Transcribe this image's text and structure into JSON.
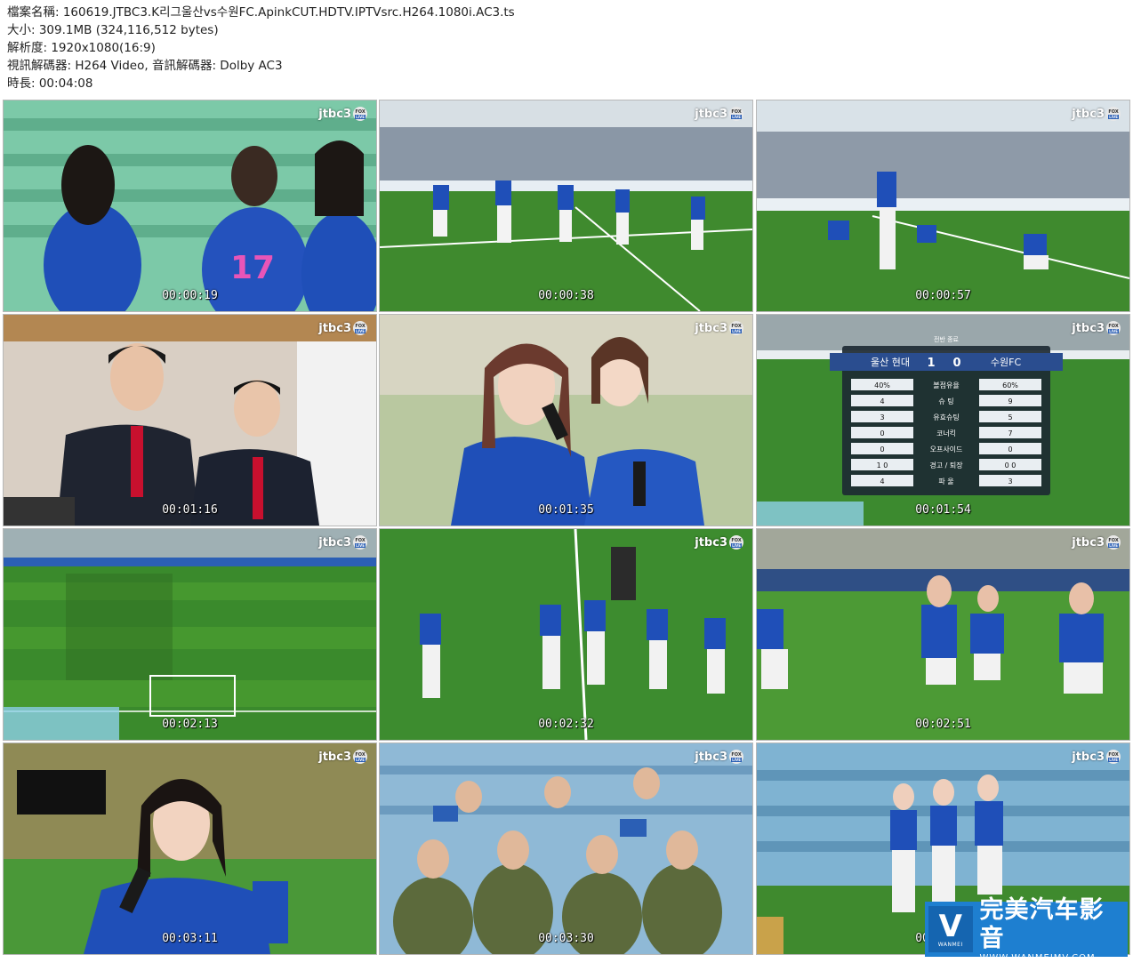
{
  "file_info": {
    "filename": "檔案名稱: 160619.JTBC3.K리그울산vs수원FC.ApinkCUT.HDTV.IPTVsrc.H264.1080i.AC3.ts",
    "size": "大小: 309.1MB (324,116,512 bytes)",
    "resolution": "解析度: 1920x1080(16:9)",
    "codecs": "視訊解碼器: H264 Video, 音訊解碼器: Dolby AC3",
    "duration": "時長: 00:04:08"
  },
  "broadcast_logo": {
    "brand": "jtbc3",
    "partner": "FOX",
    "live": "LIVE"
  },
  "thumbnails": [
    {
      "timestamp": "00:00:19"
    },
    {
      "timestamp": "00:00:38"
    },
    {
      "timestamp": "00:00:57"
    },
    {
      "timestamp": "00:01:16"
    },
    {
      "timestamp": "00:01:35"
    },
    {
      "timestamp": "00:01:54"
    },
    {
      "timestamp": "00:02:13"
    },
    {
      "timestamp": "00:02:32"
    },
    {
      "timestamp": "00:02:51"
    },
    {
      "timestamp": "00:03:11"
    },
    {
      "timestamp": "00:03:30"
    },
    {
      "timestamp": "00:03:49"
    }
  ],
  "scoreboard": {
    "half_label": "전반 종료",
    "home_team": "울산 현대",
    "away_team": "수원FC",
    "home_score": "1",
    "away_score": "0",
    "rows": [
      {
        "home": "40%",
        "label": "볼점유율",
        "away": "60%"
      },
      {
        "home": "4",
        "label": "슈 팅",
        "away": "9"
      },
      {
        "home": "3",
        "label": "유효슈팅",
        "away": "5"
      },
      {
        "home": "0",
        "label": "코너킥",
        "away": "7"
      },
      {
        "home": "0",
        "label": "오프사이드",
        "away": "0"
      },
      {
        "home": "1   0",
        "label": "경고 / 퇴장",
        "away": "0   0"
      },
      {
        "home": "4",
        "label": "파 울",
        "away": "3"
      }
    ]
  },
  "watermark": {
    "mark": "V",
    "mark_caption": "WANMEI",
    "title": "完美汽车影音",
    "url": "WWW.WANMEIMV.COM"
  },
  "colors": {
    "jersey_blue": "#1f4fb8",
    "pitch_green": "#3f8a2e",
    "seat_green": "#6fbf9a",
    "watermark_blue": "#1e7fd0"
  }
}
